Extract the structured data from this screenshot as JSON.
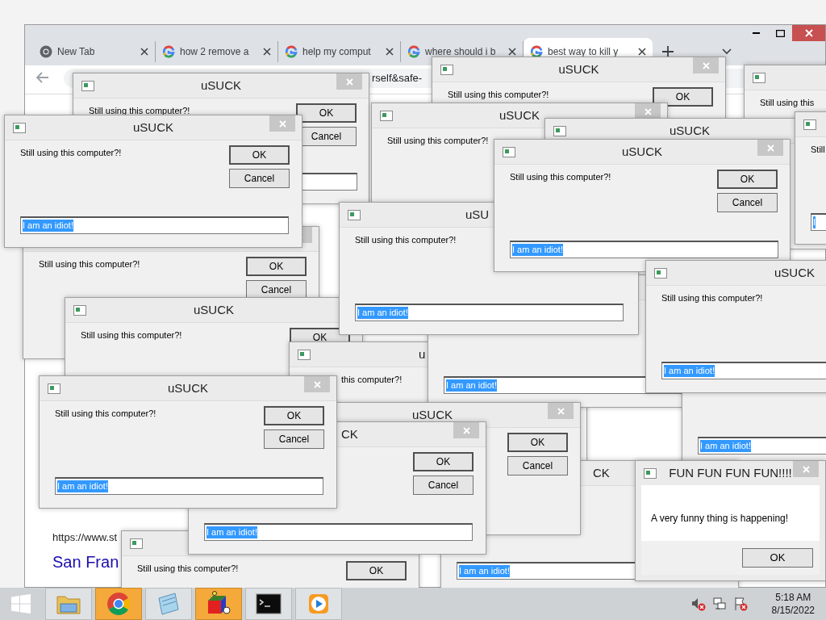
{
  "browser": {
    "tabs": [
      {
        "label": "New Tab",
        "kind": "chrome",
        "selected": false
      },
      {
        "label": "how 2 remove a",
        "kind": "google",
        "selected": false
      },
      {
        "label": "help my comput",
        "kind": "google",
        "selected": false
      },
      {
        "label": "where should i b",
        "kind": "google",
        "selected": false
      },
      {
        "label": "best way to kill y",
        "kind": "google",
        "selected": true
      }
    ],
    "address_fragment": "rself&safe-",
    "content": {
      "url": "https://www.st",
      "link": "San Fran"
    }
  },
  "dialogs": [
    {
      "kind": "prompt",
      "title": "uSUCK",
      "message": "Still using this computer?!",
      "ok": "OK",
      "cancel": "Cancel",
      "field": true
    },
    {
      "kind": "prompt",
      "title": "uSUCK",
      "message": "Still using this computer?!",
      "ok": "OK"
    },
    {
      "kind": "prompt",
      "message": "Still using this"
    },
    {
      "kind": "prompt",
      "title": "uSUCK",
      "message": "Still using this computer?!"
    },
    {
      "kind": "prompt",
      "title": "uSUCK"
    },
    {
      "kind": "prompt",
      "message": "Still",
      "field": true,
      "input": "I"
    },
    {
      "kind": "prompt",
      "message": "Still using this computer?!",
      "ok": "OK",
      "cancel": "Cancel"
    },
    {
      "kind": "prompt",
      "title": "uSUCK",
      "message": "Still using this computer?!",
      "ok": "OK"
    },
    {
      "kind": "prompt",
      "title": "uSU",
      "message": "Still using this computer?!",
      "field": true,
      "input": "I am an idiot!"
    },
    {
      "kind": "prompt",
      "field": true,
      "input": "I am an idiot!"
    },
    {
      "kind": "prompt",
      "field": true,
      "input": "I am an idiot!"
    },
    {
      "kind": "prompt",
      "title": "u",
      "message": "this computer?!"
    },
    {
      "kind": "prompt",
      "title": "uSUCK",
      "message": "Still using this computer?!",
      "ok": "OK",
      "cancel": "Cancel",
      "field": true,
      "input": "I am an idiot!"
    },
    {
      "kind": "prompt",
      "title": "uSUCK",
      "message": "Still using this computer?!",
      "field": true,
      "input": "I am an idiot!"
    },
    {
      "kind": "prompt",
      "title": "CK",
      "field": true,
      "input": "I am an idiot!"
    },
    {
      "kind": "prompt",
      "title": "uSUCK",
      "ok": "OK",
      "cancel": "Cancel"
    },
    {
      "kind": "prompt",
      "message": "Still using this computer?!",
      "ok": "OK"
    },
    {
      "kind": "prompt",
      "title": "CK",
      "ok": "OK",
      "cancel": "Cancel",
      "field": true,
      "input": "I am an idiot!"
    },
    {
      "kind": "prompt",
      "title": "uSUCK",
      "message": "Still using this computer?!",
      "ok": "OK",
      "cancel": "Cancel",
      "field": true,
      "input": "I am an idiot!"
    },
    {
      "kind": "prompt",
      "title": "uSUCK",
      "message": "Still using this computer?!",
      "ok": "OK",
      "cancel": "Cancel",
      "field": true,
      "input": "I am an idiot!"
    },
    {
      "kind": "alert",
      "title": "FUN FUN FUN FUN!!!!",
      "message": "A very funny thing is happening!",
      "ok": "OK"
    }
  ],
  "taskbar": {
    "apps": [
      {
        "kind": "explorer",
        "selected": false
      },
      {
        "kind": "chrome",
        "selected": true
      },
      {
        "kind": "notepad",
        "selected": false
      },
      {
        "kind": "shapes",
        "selected": true
      },
      {
        "kind": "console",
        "selected": false
      },
      {
        "kind": "player",
        "selected": false
      }
    ],
    "time": "5:18 AM",
    "date": "8/15/2022"
  }
}
